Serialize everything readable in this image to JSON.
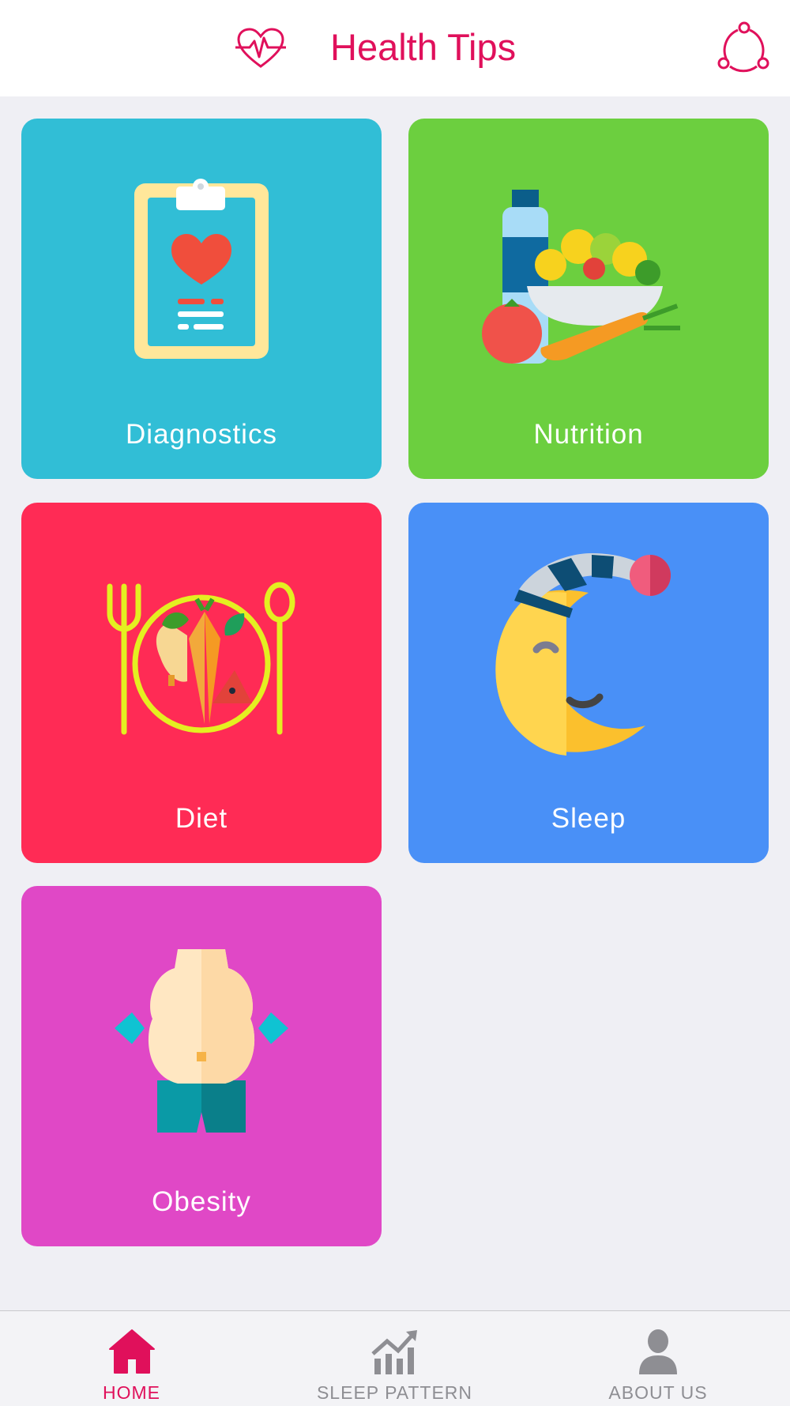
{
  "header": {
    "title": "Health Tips",
    "logo_icon": "heartbeat-icon",
    "share_icon": "share-icon",
    "accent_color": "#e0105b"
  },
  "tiles": [
    {
      "label": "Diagnostics",
      "icon": "clipboard-heart-icon",
      "color": "#31bed6"
    },
    {
      "label": "Nutrition",
      "icon": "food-bowl-icon",
      "color": "#6ccf3f"
    },
    {
      "label": "Diet",
      "icon": "plate-fork-spoon-icon",
      "color": "#ff2b55"
    },
    {
      "label": "Sleep",
      "icon": "moon-sleep-icon",
      "color": "#4990f7"
    },
    {
      "label": "Obesity",
      "icon": "belly-icon",
      "color": "#e048c6"
    }
  ],
  "tabbar": {
    "tabs": [
      {
        "label": "HOME",
        "icon": "home-icon",
        "active": true
      },
      {
        "label": "SLEEP PATTERN",
        "icon": "chart-trend-icon",
        "active": false
      },
      {
        "label": "ABOUT US",
        "icon": "person-icon",
        "active": false
      }
    ],
    "active_color": "#e0105b",
    "inactive_color": "#8e8e93"
  }
}
